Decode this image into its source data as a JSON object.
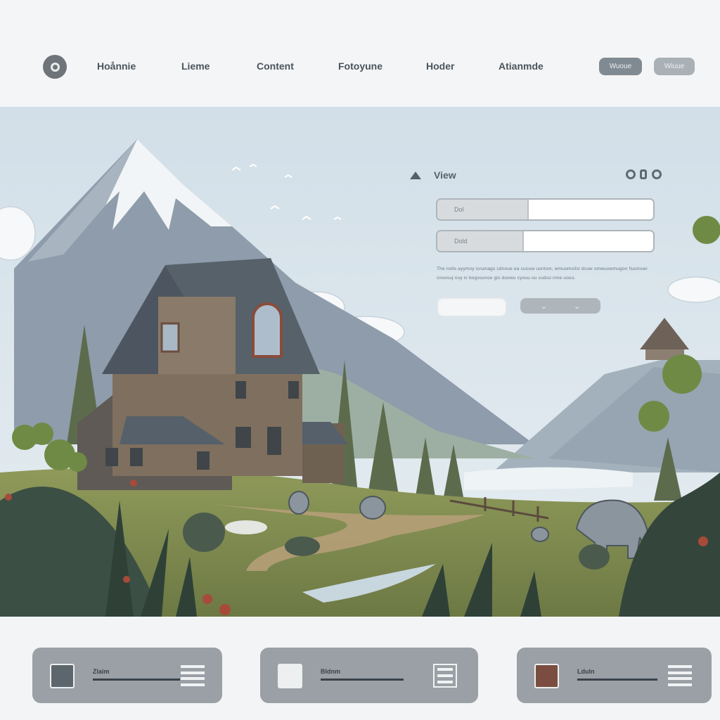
{
  "nav": {
    "logo_icon": "circle-logo-icon",
    "links": [
      "Hoånnie",
      "Lieme",
      "Content",
      "Fotoyune",
      "Hoder",
      "Atianmde"
    ],
    "primary_button": "Wuoue",
    "secondary_button": "Wiuue"
  },
  "hero": {
    "panel_icon": "triangle-icon",
    "panel_title": "View",
    "controls": [
      "minimize-icon",
      "restore-icon",
      "close-icon"
    ],
    "fields": [
      {
        "label": "Dol",
        "value": ""
      },
      {
        "label": "Dold",
        "value": ""
      }
    ],
    "description": "The nolls ayymoy icnanags cdnoue ea cuouw uontsm, wmuomoilsi dcuw omwuowmugon fiuomuei cnoosuj nuy ic bogxounce gis duowu cyouu ou cudso nme uouo.",
    "select_chevrons": [
      "⌄",
      "⌄"
    ]
  },
  "cards": [
    {
      "thumb_icon": "frame-icon",
      "title": "Zlaim",
      "menu_icon": "hamburger-icon"
    },
    {
      "thumb_icon": "house-icon",
      "title": "Bldnm",
      "menu_icon": "layout-icon"
    },
    {
      "thumb_icon": "camera-icon",
      "title": "Lduln",
      "menu_icon": "hamburger-icon"
    }
  ],
  "colors": {
    "nav_bg": "#f4f5f6",
    "sky": "#dbe5ec",
    "card_bg": "#9aa0a5",
    "primary_button": "#808a93",
    "secondary_button": "#a9b0b6"
  }
}
